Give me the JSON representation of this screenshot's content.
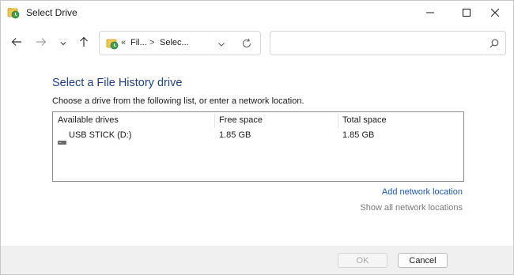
{
  "window": {
    "title": "Select Drive",
    "controls": {
      "minimize_icon": "minimize-icon",
      "maximize_icon": "maximize-icon",
      "close_icon": "close-icon"
    }
  },
  "nav": {
    "back_icon": "arrow-left-icon",
    "forward_icon": "arrow-right-icon",
    "recent_icon": "chevron-down-icon",
    "up_icon": "arrow-up-icon"
  },
  "address": {
    "overflow": "«",
    "crumbs": [
      "Fil...",
      "Selec..."
    ],
    "separator": ">",
    "search_placeholder": ""
  },
  "main": {
    "heading": "Select a File History drive",
    "subtext": "Choose a drive from the following list, or enter a network location.",
    "table": {
      "columns": [
        "Available drives",
        "Free space",
        "Total space"
      ],
      "rows": [
        {
          "name": "USB STICK (D:)",
          "free": "1.85 GB",
          "total": "1.85 GB"
        }
      ]
    },
    "add_network_location": "Add network location",
    "show_all_network_locations": "Show all network locations"
  },
  "footer": {
    "ok_label": "OK",
    "cancel_label": "Cancel"
  },
  "colors": {
    "heading": "#1e3f8a",
    "link": "#1a56c4",
    "disabled_link": "#7a7a7a",
    "footer_bg": "#f0f0f0"
  }
}
